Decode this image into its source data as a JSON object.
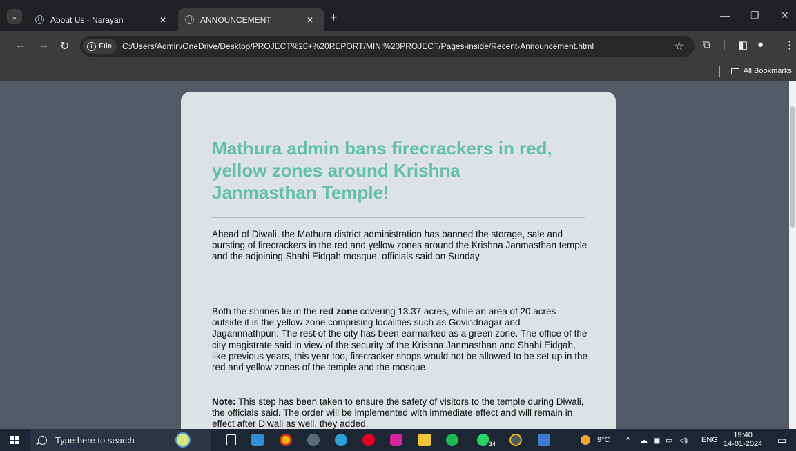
{
  "browser": {
    "tabs": [
      {
        "title": "About Us - Narayan",
        "active": false
      },
      {
        "title": "ANNOUNCEMENT",
        "active": true
      }
    ],
    "address": {
      "scheme_label": "File",
      "url": "C:/Users/Admin/OneDrive/Desktop/PROJECT%20+%20REPORT/MINI%20PROJECT/Pages-inside/Recent-Announcement.html"
    },
    "bookmarks_label": "All Bookmarks"
  },
  "article": {
    "title": "Mathura admin bans firecrackers in red, yellow zones around Krishna Janmasthan Temple!",
    "paragraph1": "Ahead of Diwali, the Mathura district administration has banned the storage, sale and bursting of firecrackers in the red and yellow zones around the Krishna Janmasthan temple and the adjoining Shahi Eidgah mosque, officials said on Sunday.",
    "paragraph2_before": "Both the shrines lie in the ",
    "paragraph2_bold": "red zone",
    "paragraph2_after": " covering 13.37 acres, while an area of 20 acres outside it is the yellow zone comprising localities such as Govindnagar and Jagannnathpuri. The rest of the city has been earmarked as a green zone. The office of the city magistrate said in view of the security of the Krishna Janmasthan and Shahi Eidgah, like previous years, this year too, firecracker shops would not be allowed to be set up in the red and yellow zones of the temple and the mosque.",
    "note_label": "Note:",
    "note_text": " This step has been taken to ensure the safety of visitors to the temple during Diwali, the officials said. The order will be implemented with immediate effect and will remain in effect after Diwali as well, they added."
  },
  "taskbar": {
    "search_placeholder": "Type here to search",
    "whatsapp_badge": "34",
    "weather": "9°C",
    "language": "ENG",
    "time": "19:40",
    "date": "14-01-2024"
  },
  "colors": {
    "headline": "#62c0ab",
    "page_bg": "#535a65",
    "card_bg": "#dde2e4",
    "taskbar_bg": "#1d2633"
  }
}
